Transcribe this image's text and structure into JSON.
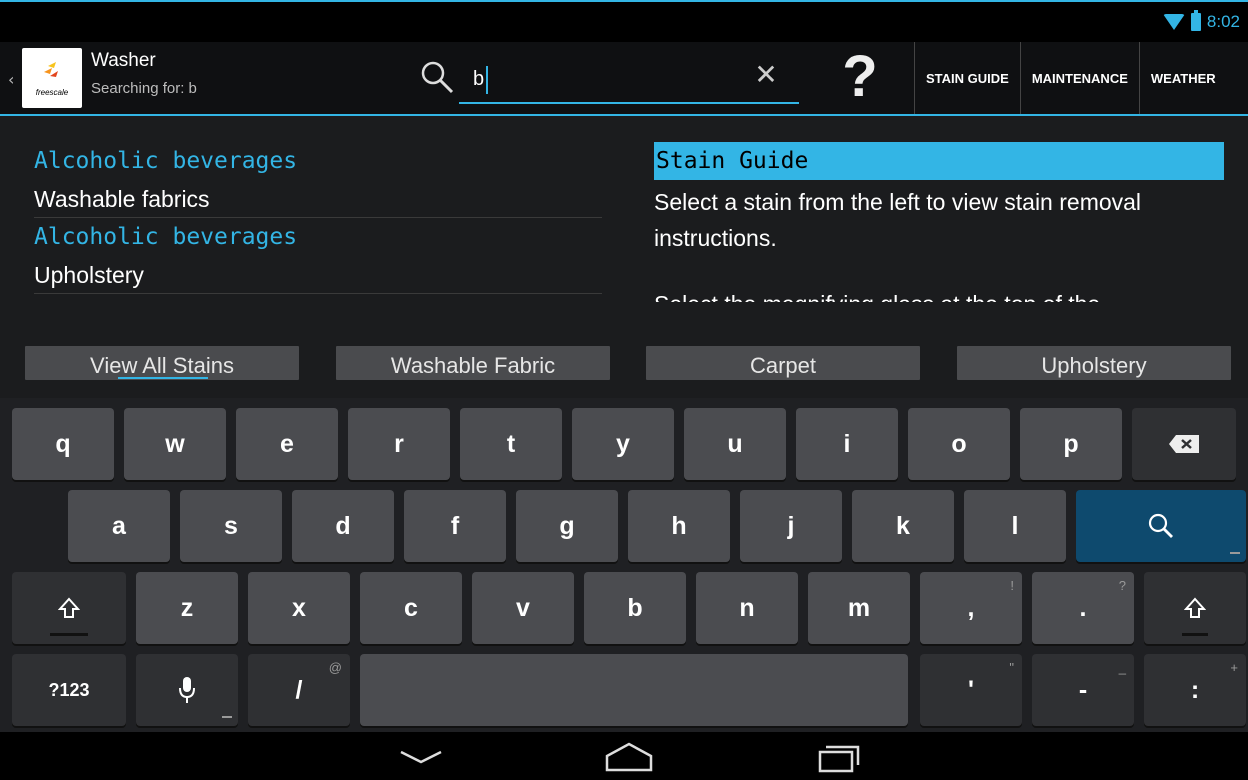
{
  "status": {
    "time": "8:02"
  },
  "app": {
    "title": "Washer",
    "subtitle": "Searching for: b",
    "logo_text": "freescale"
  },
  "search": {
    "value": "b"
  },
  "action_tabs": [
    "STAIN GUIDE",
    "MAINTENANCE",
    "WEATHER"
  ],
  "results": [
    {
      "category": "Alcoholic beverages",
      "fabric": "Washable fabrics"
    },
    {
      "category": "Alcoholic beverages",
      "fabric": "Upholstery"
    }
  ],
  "detail": {
    "title": "Stain Guide",
    "body1": "Select a stain from the left to view stain removal instructions.",
    "body2": "Select the magnifying glass at the top of the"
  },
  "filters": [
    "View All Stains",
    "Washable Fabric",
    "Carpet",
    "Upholstery"
  ],
  "keyboard": {
    "row1": [
      "q",
      "w",
      "e",
      "r",
      "t",
      "y",
      "u",
      "i",
      "o",
      "p"
    ],
    "row2": [
      "a",
      "s",
      "d",
      "f",
      "g",
      "h",
      "j",
      "k",
      "l"
    ],
    "row3": [
      "z",
      "x",
      "c",
      "v",
      "b",
      "n",
      "m",
      ",",
      "."
    ],
    "row3_hints": [
      "!",
      "?"
    ],
    "row4": {
      "symbols": "?123",
      "slash": "/",
      "slash_hint": "@",
      "quote": "'",
      "quote_hint": "\"",
      "dash": "-",
      "dash_hint": "_",
      "colon": ":",
      "colon_hint": "+"
    }
  },
  "colors": {
    "accent": "#33b5e5",
    "key": "#4b4c50",
    "search_key": "#0e4a6e"
  }
}
